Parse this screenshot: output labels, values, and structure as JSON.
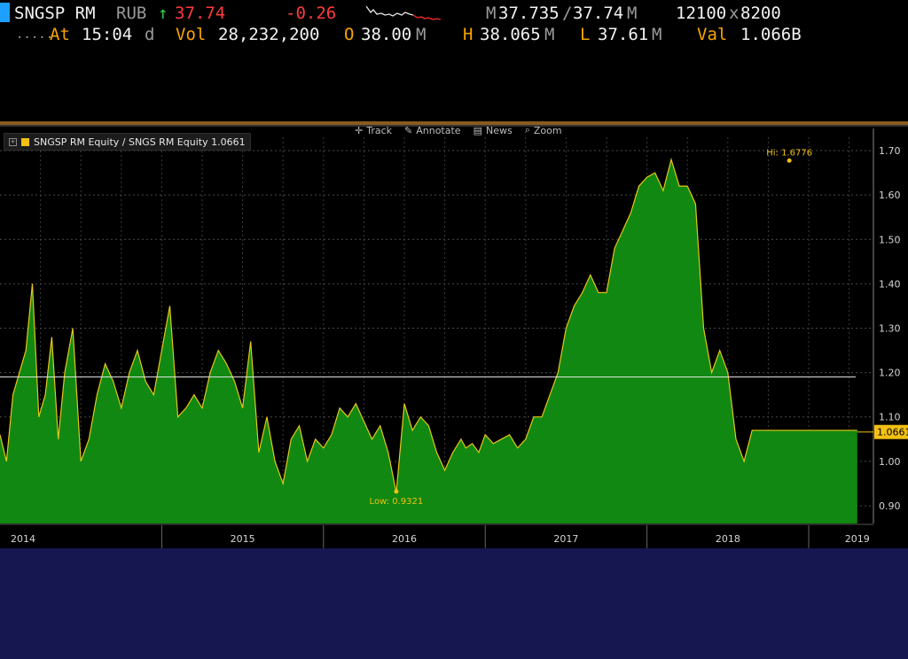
{
  "quote": {
    "ticker": "SNGSP RM",
    "currency": "RUB",
    "last": "37.74",
    "change": "-0.26",
    "bid_ask_prefix": "M",
    "bid": "37.735",
    "ask": "37.74",
    "ask_suffix": "M",
    "bid_size": "12100",
    "size_sep": "x",
    "ask_size": "8200",
    "dots": ".....",
    "at_label": "At",
    "time": "15:04",
    "time_suffix": "d",
    "vol_label": "Vol",
    "volume": "28,232,200",
    "open_label": "O",
    "open": "38.00",
    "open_suffix": "M",
    "high_label": "H",
    "high": "38.065",
    "high_suffix": "M",
    "low_label": "L",
    "low": "37.61",
    "low_suffix": "M",
    "val_label": "Val",
    "value": "1.066B",
    "colors": {
      "up_arrow": "#29d34a",
      "last": "#ff3b3b",
      "change": "#ff3b3b",
      "labels": "#f7a500"
    }
  },
  "toolbar": {
    "items": [
      {
        "label": "Track",
        "icon": "crosshair-icon"
      },
      {
        "label": "Annotate",
        "icon": "pencil-icon"
      },
      {
        "label": "News",
        "icon": "news-icon"
      },
      {
        "label": "Zoom",
        "icon": "magnifier-icon"
      }
    ]
  },
  "legend": {
    "label": "SNGSP RM Equity / SNGS RM Equity 1.0661"
  },
  "chart_data": {
    "type": "area",
    "series": [
      {
        "name": "SNGSP RM Equity / SNGS RM Equity",
        "color": "#118811",
        "line_color": "#e6c619"
      }
    ],
    "x_range": [
      2014.0,
      2019.4
    ],
    "ylim": [
      0.86,
      1.73
    ],
    "y_ticks": [
      "0.90",
      "1.00",
      "1.10",
      "1.20",
      "1.30",
      "1.40",
      "1.50",
      "1.60",
      "1.70"
    ],
    "x_labels": [
      "2014",
      "2015",
      "2016",
      "2017",
      "2018",
      "2019"
    ],
    "x_values": [
      2014.0,
      2014.04,
      2014.08,
      2014.12,
      2014.16,
      2014.2,
      2014.24,
      2014.28,
      2014.32,
      2014.36,
      2014.4,
      2014.45,
      2014.5,
      2014.55,
      2014.6,
      2014.65,
      2014.7,
      2014.75,
      2014.8,
      2014.85,
      2014.9,
      2014.95,
      2015.0,
      2015.05,
      2015.1,
      2015.15,
      2015.2,
      2015.25,
      2015.3,
      2015.35,
      2015.4,
      2015.45,
      2015.5,
      2015.55,
      2015.6,
      2015.65,
      2015.7,
      2015.75,
      2015.8,
      2015.85,
      2015.9,
      2015.95,
      2016.0,
      2016.05,
      2016.1,
      2016.15,
      2016.2,
      2016.25,
      2016.3,
      2016.35,
      2016.4,
      2016.45,
      2016.5,
      2016.55,
      2016.6,
      2016.65,
      2016.7,
      2016.75,
      2016.8,
      2016.85,
      2016.88,
      2016.92,
      2016.96,
      2017.0,
      2017.05,
      2017.1,
      2017.15,
      2017.2,
      2017.25,
      2017.3,
      2017.35,
      2017.4,
      2017.45,
      2017.5,
      2017.55,
      2017.6,
      2017.65,
      2017.7,
      2017.75,
      2017.8,
      2017.85,
      2017.9,
      2017.95,
      2018.0,
      2018.05,
      2018.1,
      2018.15,
      2018.2,
      2018.25,
      2018.3,
      2018.35,
      2018.4,
      2018.45,
      2018.5,
      2018.55,
      2018.6,
      2018.65,
      2018.7,
      2018.75,
      2018.8,
      2018.85,
      2018.88,
      2018.92,
      2018.96,
      2019.0,
      2019.04,
      2019.08,
      2019.12,
      2019.16,
      2019.2,
      2019.24,
      2019.28,
      2019.3
    ],
    "values": [
      1.06,
      1.0,
      1.15,
      1.2,
      1.25,
      1.4,
      1.1,
      1.15,
      1.28,
      1.05,
      1.2,
      1.3,
      1.0,
      1.05,
      1.15,
      1.22,
      1.18,
      1.12,
      1.2,
      1.25,
      1.18,
      1.15,
      1.25,
      1.35,
      1.1,
      1.12,
      1.15,
      1.12,
      1.2,
      1.25,
      1.22,
      1.18,
      1.12,
      1.27,
      1.02,
      1.1,
      1.0,
      0.95,
      1.05,
      1.08,
      1.0,
      1.05,
      1.03,
      1.06,
      1.12,
      1.1,
      1.13,
      1.09,
      1.05,
      1.08,
      1.02,
      0.93,
      1.13,
      1.07,
      1.1,
      1.08,
      1.02,
      0.98,
      1.02,
      1.05,
      1.03,
      1.04,
      1.02,
      1.06,
      1.04,
      1.05,
      1.06,
      1.03,
      1.05,
      1.1,
      1.1,
      1.15,
      1.2,
      1.3,
      1.35,
      1.38,
      1.42,
      1.38,
      1.38,
      1.48,
      1.52,
      1.56,
      1.62,
      1.64,
      1.65,
      1.61,
      1.68,
      1.62,
      1.62,
      1.58,
      1.3,
      1.2,
      1.25,
      1.2,
      1.05,
      1.0,
      1.07,
      1.07,
      1.07,
      1.07,
      1.07,
      1.07,
      1.07,
      1.07,
      1.07,
      1.07,
      1.07,
      1.07,
      1.07,
      1.07,
      1.07,
      1.07,
      1.07
    ],
    "average_line": 1.19,
    "annotations": [
      {
        "label": "Hi: 1.6776",
        "x": 2018.88,
        "y": 1.6776
      },
      {
        "label": "Low: 0.9321",
        "x": 2016.45,
        "y": 0.9321
      }
    ],
    "last_value_label": "1.0661",
    "last_value": 1.0661,
    "grid": true
  }
}
